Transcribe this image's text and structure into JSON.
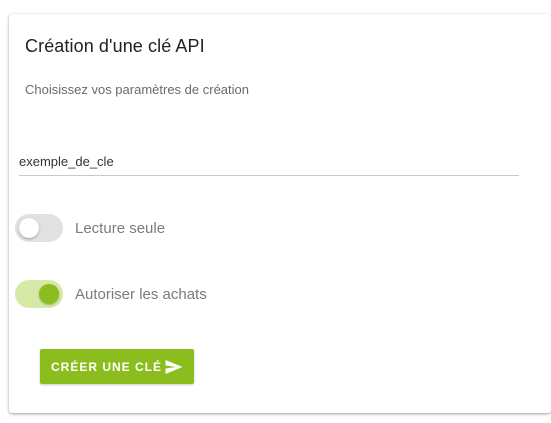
{
  "dialog": {
    "title": "Création d'une clé API",
    "subtitle": "Choisissez vos paramètres de création"
  },
  "key_name_field": {
    "value": "exemple_de_cle"
  },
  "toggles": [
    {
      "label": "Lecture seule",
      "checked": false
    },
    {
      "label": "Autoriser les achats",
      "checked": true
    }
  ],
  "create_button": {
    "label": "CRÉER UNE CLÉ",
    "icon": "send-icon"
  },
  "colors": {
    "accent": "#8bbd1e",
    "accent_light": "#d6e9a7",
    "toggle_off_track": "#e1e1e1"
  }
}
